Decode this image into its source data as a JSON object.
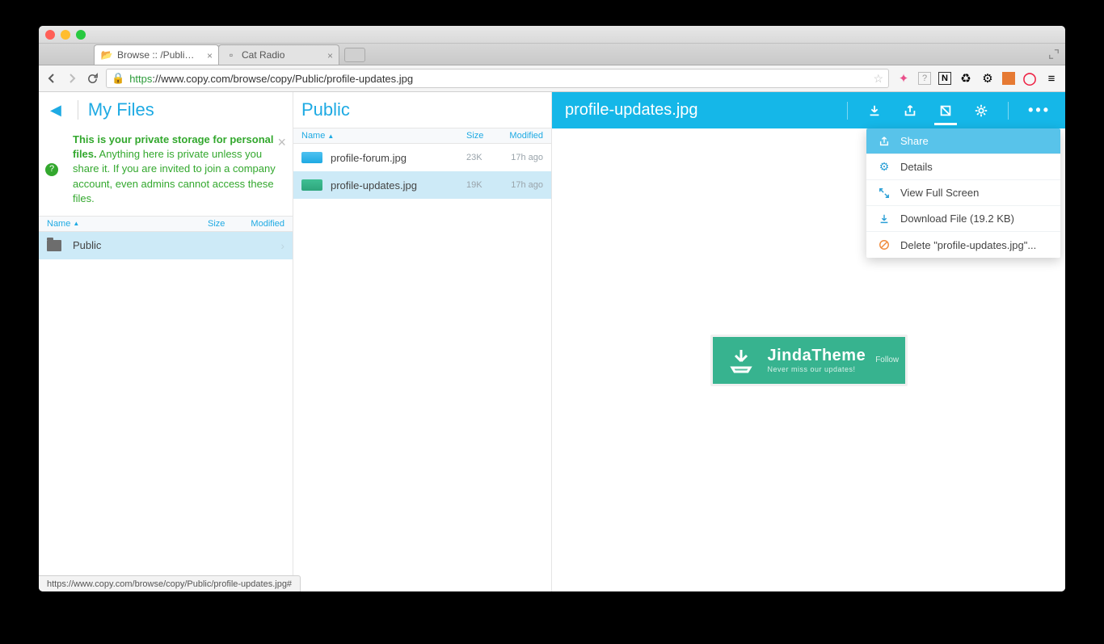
{
  "browser": {
    "tabs": [
      {
        "label": "Browse :: /Public/profile-u...",
        "active": true
      },
      {
        "label": "Cat Radio",
        "active": false
      }
    ],
    "url_https": "https",
    "url_rest": "://www.copy.com/browse/copy/Public/profile-updates.jpg",
    "status_url": "https://www.copy.com/browse/copy/Public/profile-updates.jpg#"
  },
  "sidebar": {
    "title": "My Files",
    "info_strong": "This is your private storage for personal files.",
    "info_rest": " Anything here is private unless you share it. If you are invited to join a company account, even admins cannot access these files.",
    "headers": {
      "name": "Name",
      "size": "Size",
      "modified": "Modified"
    },
    "items": [
      {
        "label": "Public"
      }
    ]
  },
  "middle": {
    "title": "Public",
    "headers": {
      "name": "Name",
      "size": "Size",
      "modified": "Modified"
    },
    "files": [
      {
        "label": "profile-forum.jpg",
        "size": "23K",
        "modified": "17h ago",
        "thumb": "blue"
      },
      {
        "label": "profile-updates.jpg",
        "size": "19K",
        "modified": "17h ago",
        "thumb": "green",
        "selected": true
      }
    ]
  },
  "detail": {
    "title": "profile-updates.jpg",
    "preview": {
      "brand": "JindaTheme",
      "sub": "Never miss our updates!",
      "follow": "Follow"
    },
    "menu": [
      {
        "label": "Share",
        "icon": "share",
        "highlight": true
      },
      {
        "label": "Details",
        "icon": "details"
      },
      {
        "label": "View Full Screen",
        "icon": "full"
      },
      {
        "label": "Download File (19.2 KB)",
        "icon": "dl"
      },
      {
        "label": "Delete \"profile-updates.jpg\"...",
        "icon": "del"
      }
    ]
  }
}
